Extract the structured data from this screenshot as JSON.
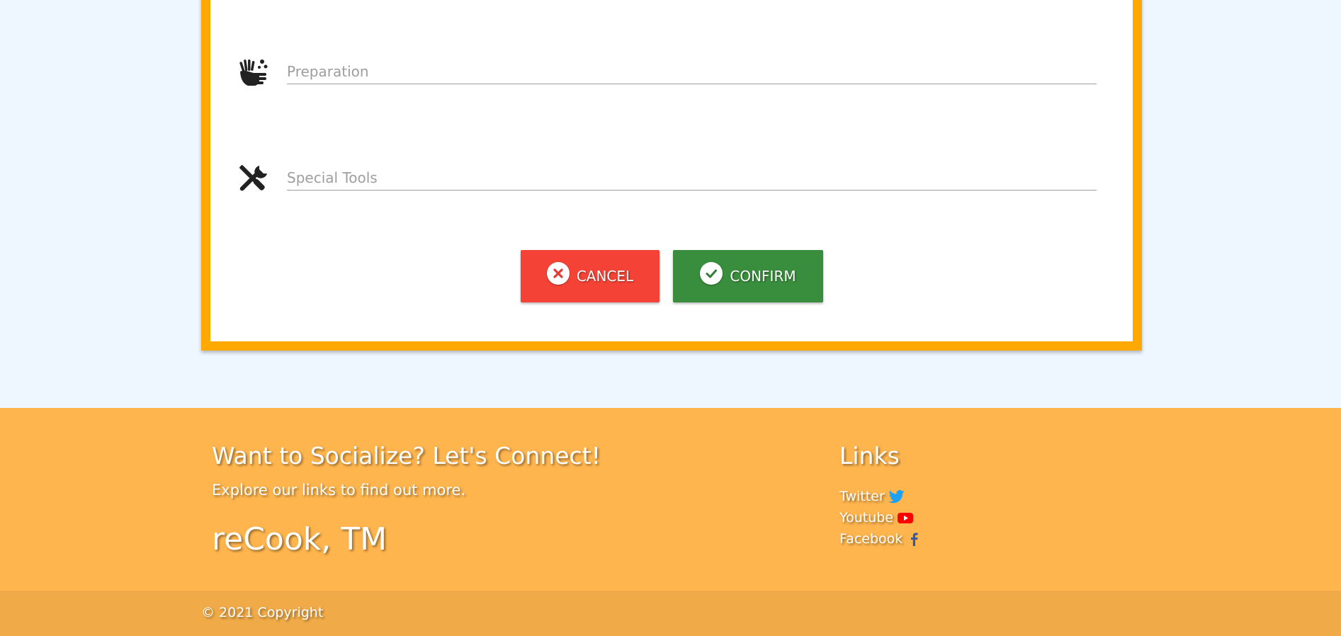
{
  "form": {
    "preparation": {
      "placeholder": "Preparation",
      "icon": "hand-wash-icon"
    },
    "special_tools": {
      "placeholder": "Special Tools",
      "icon": "tools-icon"
    },
    "cancel_label": "CANCEL",
    "confirm_label": "CONFIRM"
  },
  "footer": {
    "heading": "Want to Socialize? Let's Connect!",
    "subtext": "Explore our links to find out more.",
    "brand": "reCook, TM",
    "links_heading": "Links",
    "links": [
      {
        "label": "Twitter",
        "icon": "twitter-icon"
      },
      {
        "label": "Youtube",
        "icon": "youtube-icon"
      },
      {
        "label": "Facebook",
        "icon": "facebook-icon"
      }
    ],
    "copyright": "© 2021 Copyright"
  },
  "colors": {
    "page_bg": "#eef6ff",
    "card_border": "#ffa800",
    "cancel": "#f44336",
    "confirm": "#388e3c",
    "footer_bg": "#ffb54d",
    "copyright_bg": "#f0aa47",
    "twitter": "#1da1f2",
    "youtube": "#ff0000",
    "facebook": "#3b5998"
  }
}
